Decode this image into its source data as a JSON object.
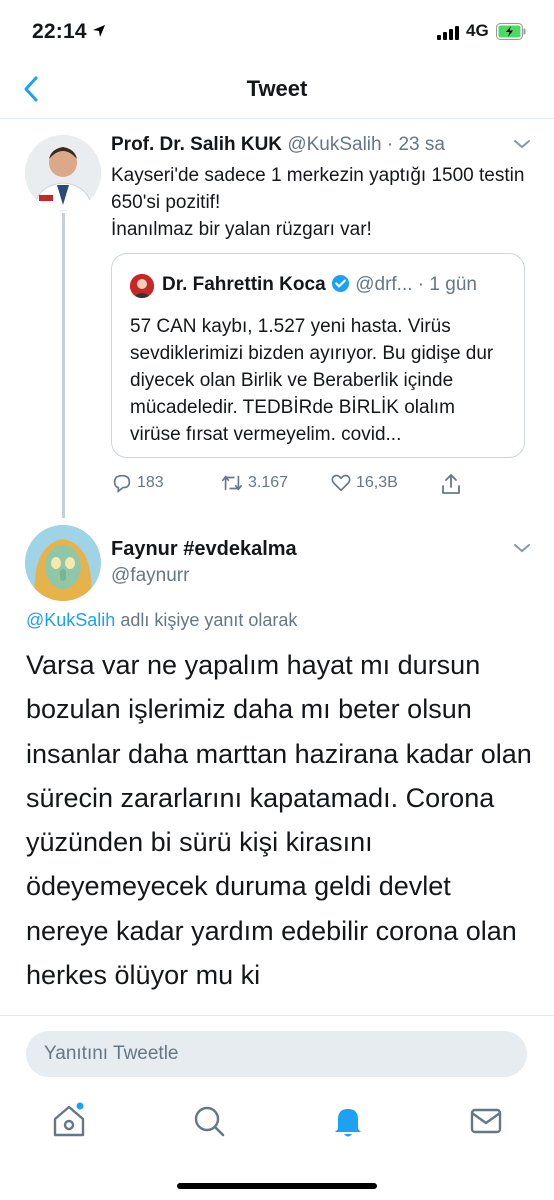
{
  "status_bar": {
    "time": "22:14",
    "network": "4G"
  },
  "nav": {
    "title": "Tweet"
  },
  "tweet1": {
    "name": "Prof. Dr. Salih KUK",
    "handle": "@KukSalih",
    "time": "· 23 sa",
    "text": "Kayseri'de sadece 1 merkezin yaptığı 1500 testin 650'si pozitif!\nİnanılmaz bir yalan rüzgarı var!",
    "quote": {
      "name": "Dr. Fahrettin Koca",
      "handle": "@drf...",
      "time": "· 1 gün",
      "text": "57 CAN kaybı, 1.527 yeni hasta. Virüs sevdiklerimizi bizden ayırıyor. Bu gidişe dur diyecek olan Birlik ve Beraberlik içinde mücadeledir. TEDBİRde BİRLİK olalım virüse fırsat vermeyelim. covid..."
    },
    "replies": "183",
    "retweets": "3.167",
    "likes": "16,3B"
  },
  "tweet2": {
    "name": "Faynur #evdekalma",
    "handle": "@faynurr",
    "replying_handle": "@KukSalih",
    "replying_suffix": " adlı kişiye yanıt olarak",
    "text": "Varsa var ne yapalım hayat mı dursun bozulan işlerimiz daha mı beter olsun insanlar daha marttan hazirana kadar olan sürecin zararlarını kapatamadı. Corona yüzünden bi sürü kişi kirasını ödeyemeyecek duruma geldi devlet nereye kadar yardım edebilir corona olan herkes ölüyor mu ki"
  },
  "reply_input": {
    "placeholder": "Yanıtını Tweetle"
  },
  "colors": {
    "accent": "#1da1f2",
    "muted": "#657786",
    "verified": "#1da1f2",
    "battery": "#4cd964"
  },
  "tab_bar": [
    "home-icon",
    "search-icon",
    "bell-icon",
    "mail-icon"
  ]
}
